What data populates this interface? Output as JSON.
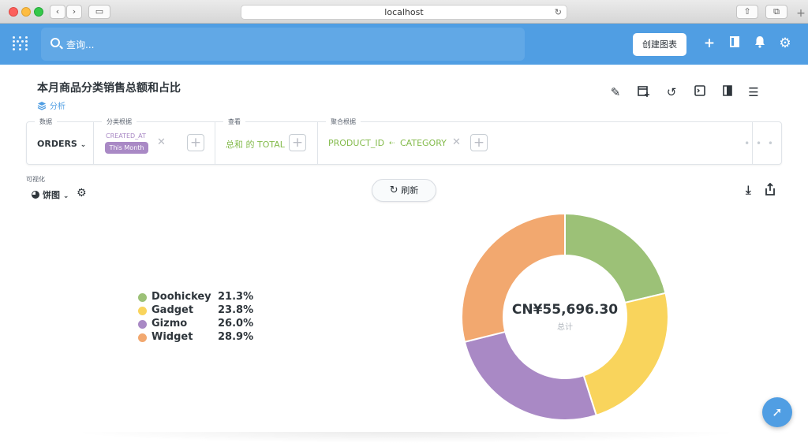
{
  "browser": {
    "url": "localhost",
    "new_tab_label": "+"
  },
  "nav": {
    "search_placeholder": "查询...",
    "create_button": "创建图表",
    "colors": {
      "background": "#509ee3",
      "search_bg": "#61a8e6"
    }
  },
  "question": {
    "title": "本月商品分类销售总额和占比",
    "collection": "分析",
    "header_icons": [
      "pencil-icon",
      "add-to-dashboard-icon",
      "history-icon",
      "embed-icon",
      "bookmark-icon",
      "menu-icon"
    ]
  },
  "query_builder": {
    "data_label": "数据",
    "data_value": "ORDERS",
    "filter_label": "分类根据",
    "filter_field": "CREATED_AT",
    "filter_value": "This Month",
    "view_label": "查看",
    "view_value": "总和 的 TOTAL",
    "group_label": "聚合根据",
    "group_field_1": "PRODUCT_ID",
    "group_field_2": "CATEGORY",
    "more": "• • •",
    "colors": {
      "filter": "#a989c5",
      "metric": "#84bb4c"
    }
  },
  "visualization": {
    "label": "可视化",
    "type": "饼图",
    "refresh_label": "刷新"
  },
  "chart_data": {
    "type": "pie",
    "categories": [
      "Doohickey",
      "Gadget",
      "Gizmo",
      "Widget"
    ],
    "values": [
      21.3,
      23.8,
      26.0,
      28.9
    ],
    "labels": [
      "21.3%",
      "23.8%",
      "26.0%",
      "28.9%"
    ],
    "colors": [
      "#9cc177",
      "#f9d45c",
      "#a989c5",
      "#f2a86f"
    ],
    "total": "CN¥55,696.30",
    "total_label": "总计"
  }
}
